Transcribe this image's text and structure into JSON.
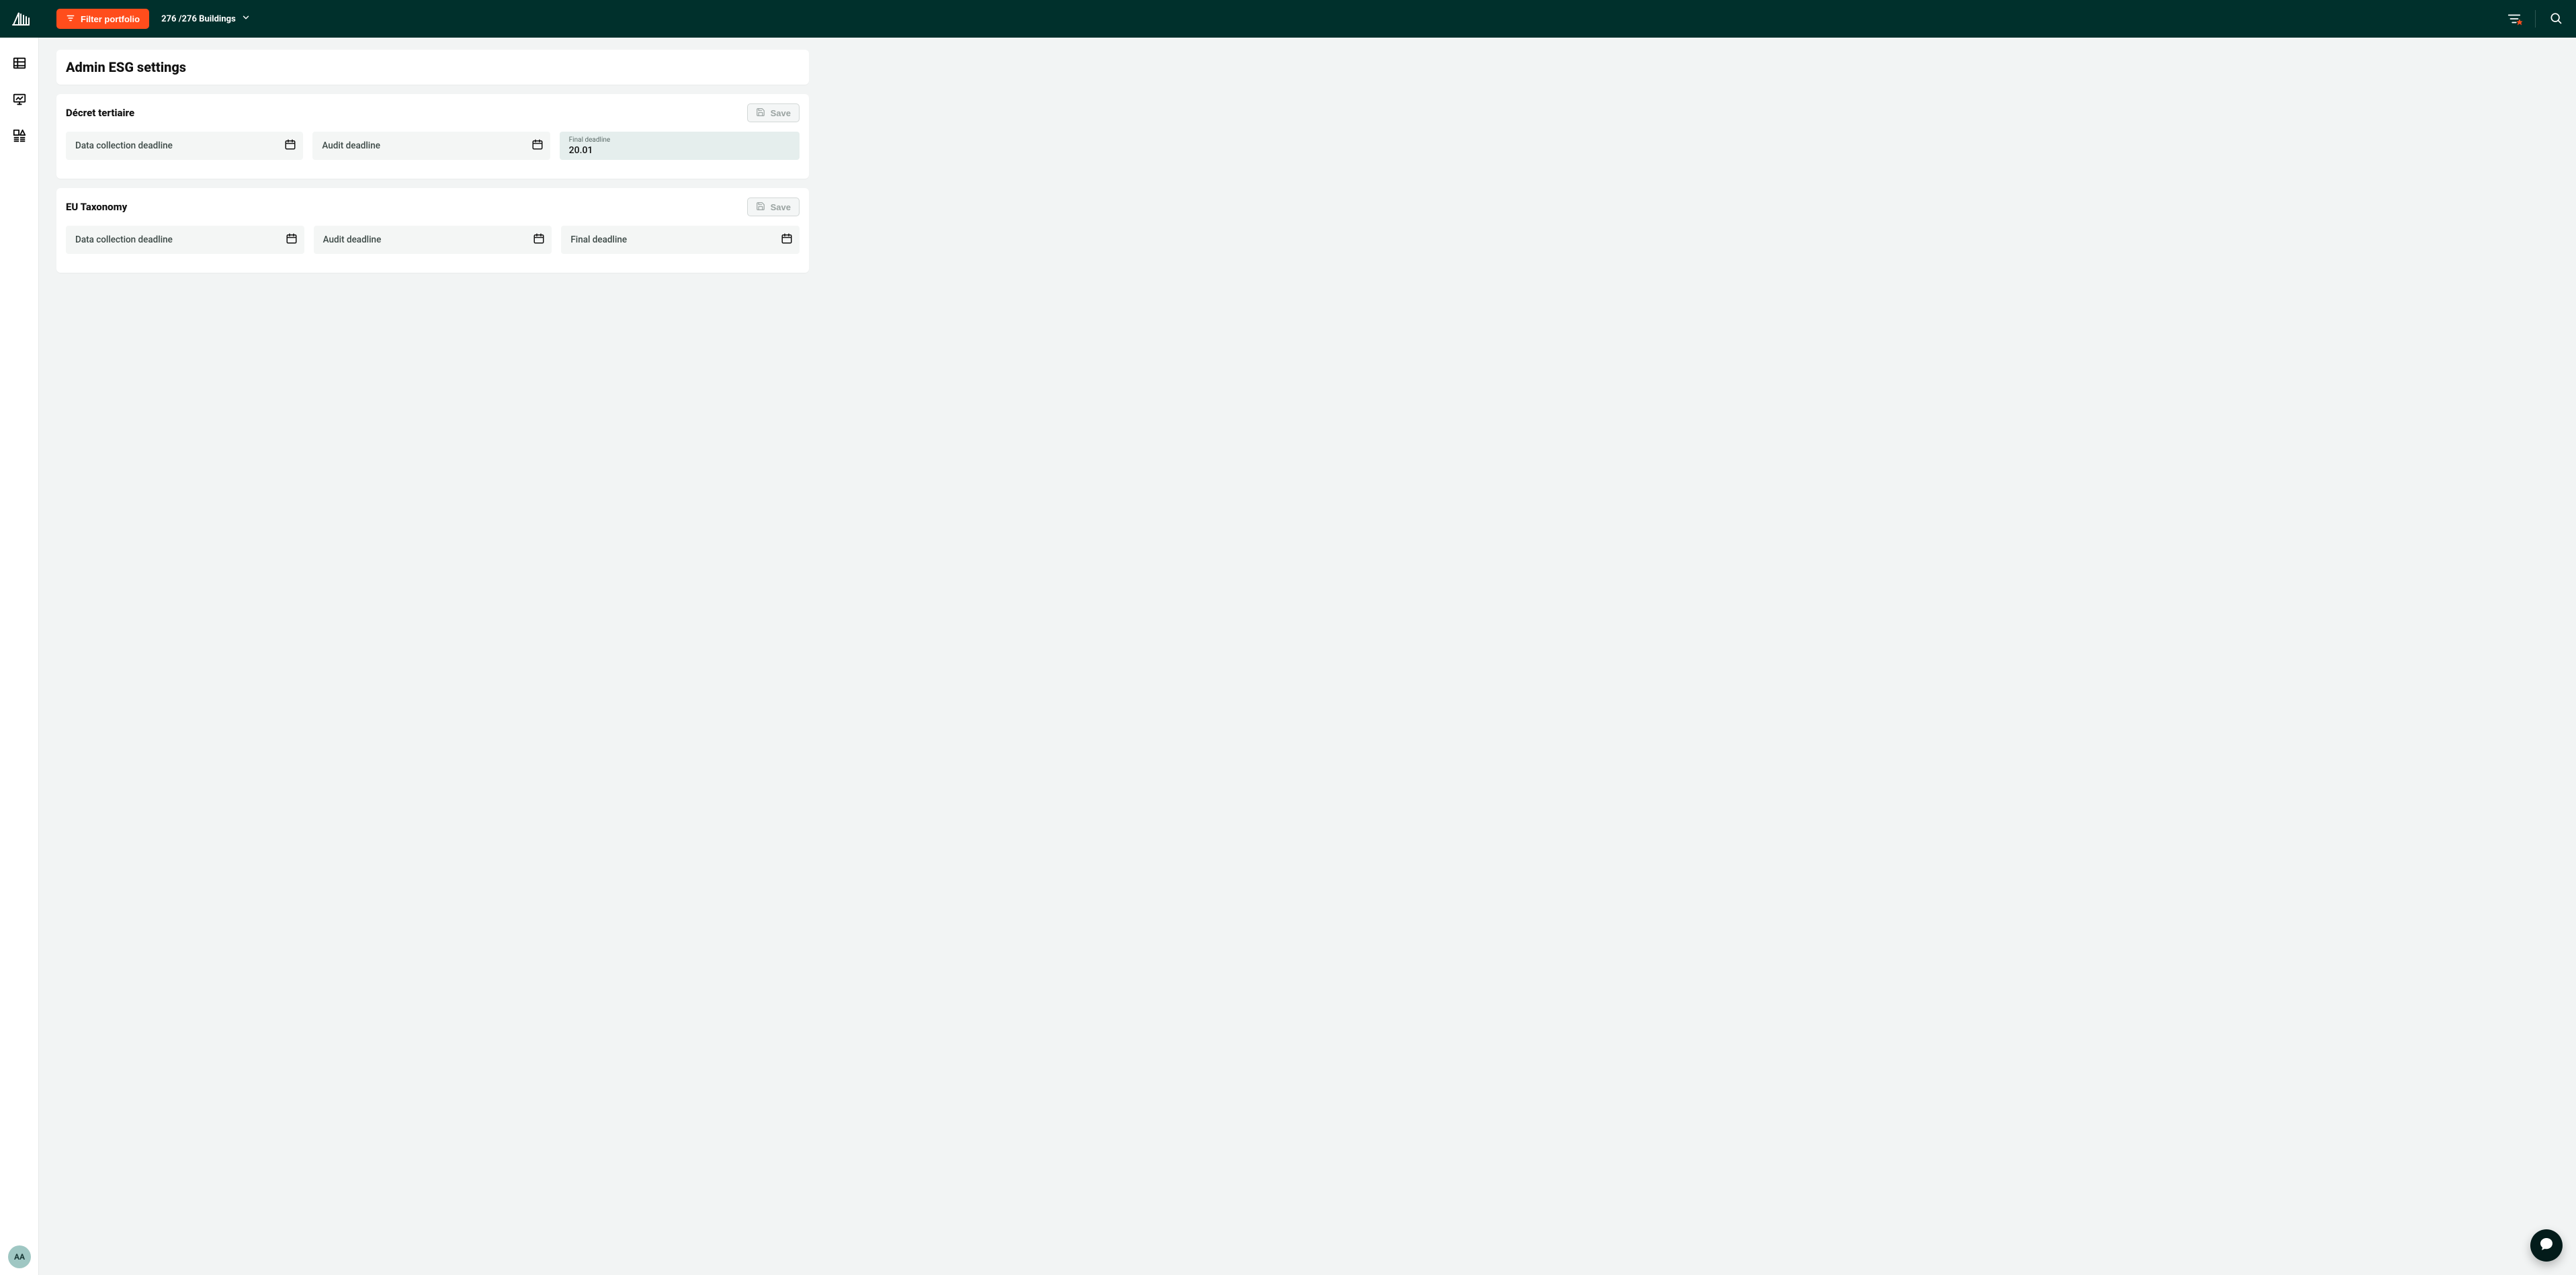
{
  "header": {
    "filter_label": "Filter portfolio",
    "count_text": "276 /276 Buildings"
  },
  "page": {
    "title": "Admin ESG settings"
  },
  "sections": [
    {
      "title": "Décret tertiaire",
      "save_label": "Save",
      "fields": [
        {
          "label": "Data collection deadline",
          "value": ""
        },
        {
          "label": "Audit deadline",
          "value": ""
        },
        {
          "label": "Final deadline",
          "value": "20.01"
        }
      ]
    },
    {
      "title": "EU Taxonomy",
      "save_label": "Save",
      "fields": [
        {
          "label": "Data collection deadline",
          "value": ""
        },
        {
          "label": "Audit deadline",
          "value": ""
        },
        {
          "label": "Final deadline",
          "value": ""
        }
      ]
    }
  ],
  "avatar": {
    "initials": "AA"
  }
}
